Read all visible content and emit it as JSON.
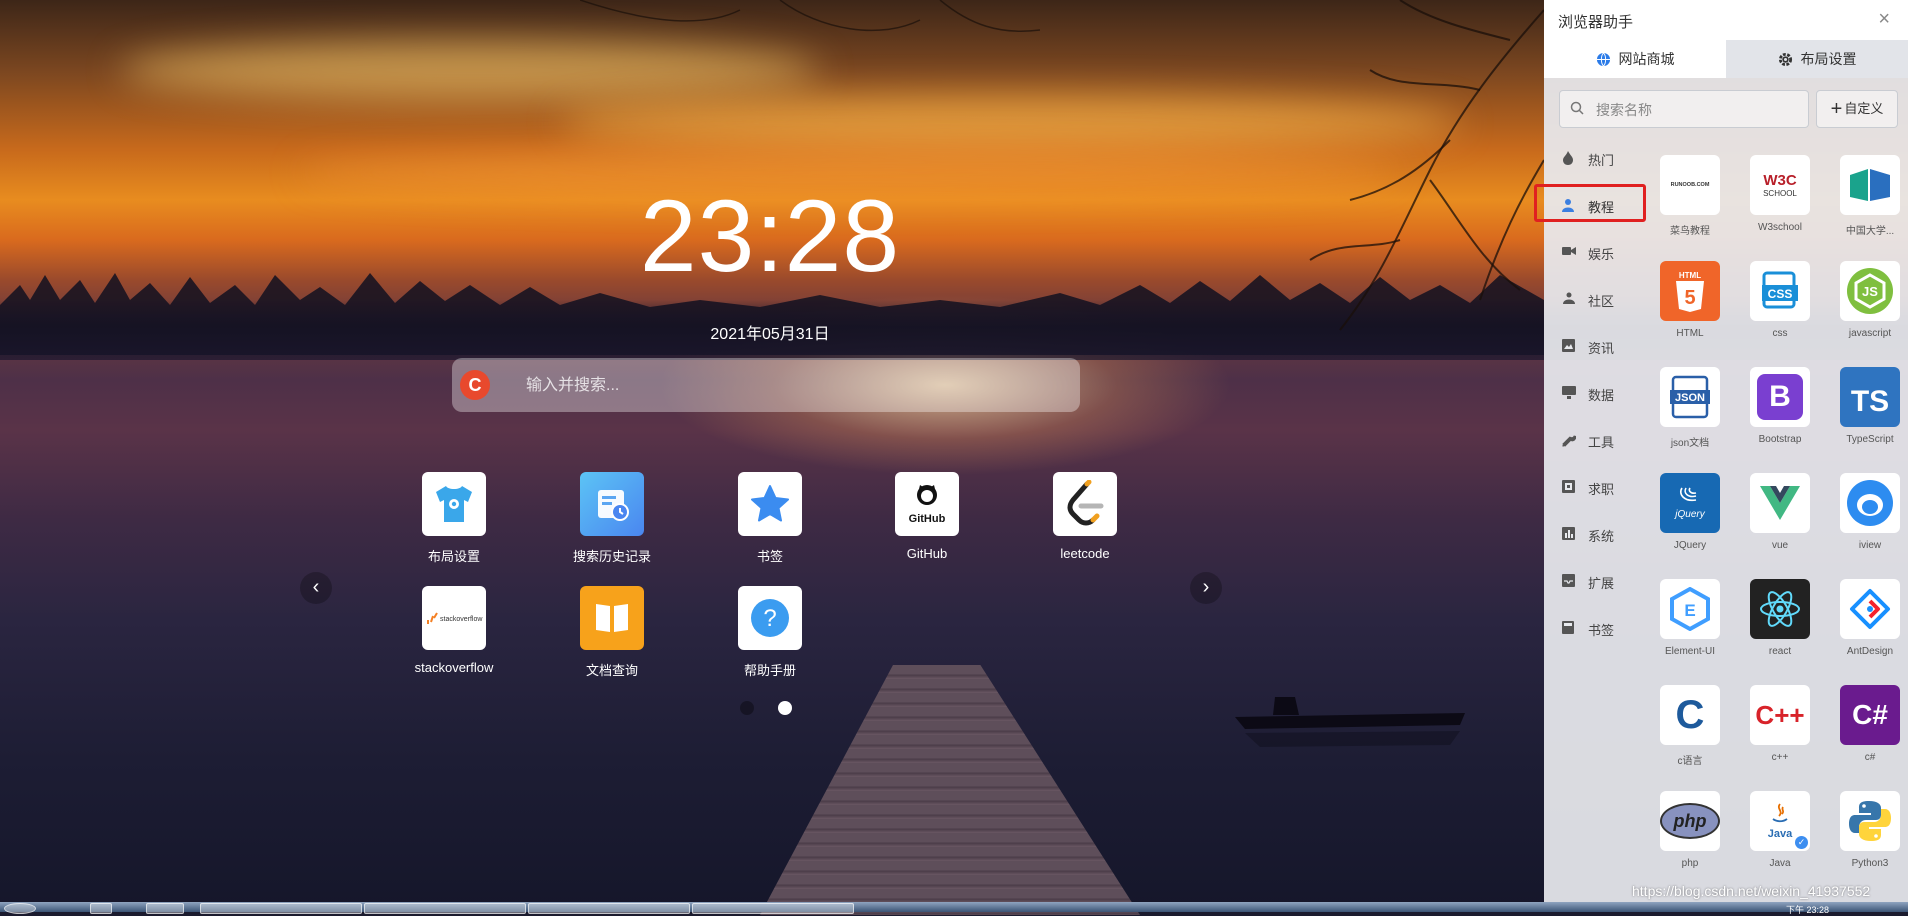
{
  "clock": {
    "time": "23:28",
    "date": "2021年05月31日"
  },
  "search": {
    "placeholder": "输入并搜索..."
  },
  "apps": [
    {
      "label": "布局设置",
      "icon": "shirt-icon"
    },
    {
      "label": "搜索历史记录",
      "icon": "history-icon"
    },
    {
      "label": "书签",
      "icon": "star-icon"
    },
    {
      "label": "GitHub",
      "icon": "github-icon"
    },
    {
      "label": "leetcode",
      "icon": "leetcode-icon"
    },
    {
      "label": "stackoverflow",
      "icon": "stackoverflow-icon"
    },
    {
      "label": "文档查询",
      "icon": "book-icon"
    },
    {
      "label": "帮助手册",
      "icon": "help-icon"
    }
  ],
  "pagination": {
    "pages": 2,
    "active": 2
  },
  "panel": {
    "title": "浏览器助手",
    "tabs": [
      {
        "label": "网站商城",
        "active": true,
        "icon": "globe-icon"
      },
      {
        "label": "布局设置",
        "active": false,
        "icon": "gear-icon"
      }
    ],
    "search_placeholder": "搜索名称",
    "custom_button": "自定义",
    "categories": [
      {
        "label": "热门",
        "icon": "flame-icon"
      },
      {
        "label": "教程",
        "icon": "user-icon",
        "active": true
      },
      {
        "label": "娱乐",
        "icon": "video-icon"
      },
      {
        "label": "社区",
        "icon": "community-icon"
      },
      {
        "label": "资讯",
        "icon": "image-icon"
      },
      {
        "label": "数据",
        "icon": "monitor-icon"
      },
      {
        "label": "工具",
        "icon": "wrench-icon"
      },
      {
        "label": "求职",
        "icon": "job-icon"
      },
      {
        "label": "系统",
        "icon": "chart-icon"
      },
      {
        "label": "扩展",
        "icon": "inbox-icon"
      },
      {
        "label": "书签",
        "icon": "bookmark-icon"
      }
    ],
    "sites": [
      {
        "label": "菜鸟教程",
        "logo": "RUNOOB.COM"
      },
      {
        "label": "W3school",
        "logo": "W3C"
      },
      {
        "label": "中国大学...",
        "logo": "mooc"
      },
      {
        "label": "HTML",
        "logo": "5"
      },
      {
        "label": "css",
        "logo": "CSS"
      },
      {
        "label": "javascript",
        "logo": "JS"
      },
      {
        "label": "json文档",
        "logo": "JSON"
      },
      {
        "label": "Bootstrap",
        "logo": "B"
      },
      {
        "label": "TypeScript",
        "logo": "TS"
      },
      {
        "label": "JQuery",
        "logo": "jQuery"
      },
      {
        "label": "vue",
        "logo": "V"
      },
      {
        "label": "iview",
        "logo": "iview"
      },
      {
        "label": "Element-UI",
        "logo": "E"
      },
      {
        "label": "react",
        "logo": "react"
      },
      {
        "label": "AntDesign",
        "logo": "ant"
      },
      {
        "label": "c语言",
        "logo": "C"
      },
      {
        "label": "c++",
        "logo": "C++"
      },
      {
        "label": "c#",
        "logo": "C#"
      },
      {
        "label": "php",
        "logo": "php"
      },
      {
        "label": "Java",
        "logo": "Java"
      },
      {
        "label": "Python3",
        "logo": "python"
      }
    ]
  },
  "watermark": "https://blog.csdn.net/weixin_41937552",
  "taskbar_clock": "下午 23:28"
}
